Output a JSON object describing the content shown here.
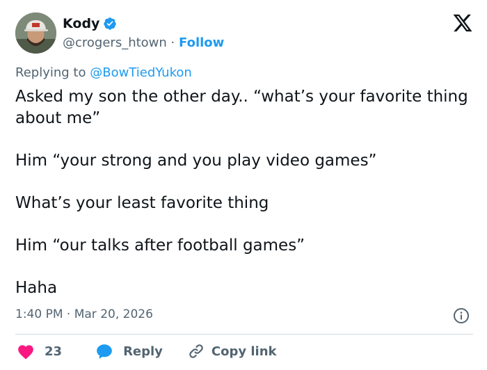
{
  "author": {
    "display_name": "Kody",
    "handle": "@crogers_htown",
    "separator": "·",
    "follow_label": "Follow"
  },
  "reply_context": {
    "prefix": "Replying to",
    "mention": "@BowTiedYukon"
  },
  "tweet": {
    "paragraphs": [
      "Asked my son the other day.. “what’s your favorite thing about me”",
      "Him “your strong and you play video games”",
      "What’s your least favorite thing",
      "Him “our talks after football games”",
      "Haha"
    ],
    "time": "1:40 PM",
    "separator": "·",
    "date": "Mar 20, 2026"
  },
  "actions": {
    "like_count": "23",
    "reply_label": "Reply",
    "copy_link_label": "Copy link"
  },
  "icons": {
    "verified": "verified-badge-icon",
    "brand": "x-logo-icon",
    "info": "info-icon",
    "like": "heart-icon",
    "reply": "speech-bubble-icon",
    "copy": "link-icon"
  },
  "colors": {
    "text": "#0f1419",
    "secondary": "#536471",
    "accent": "#1d9bf0",
    "like": "#f91880",
    "divider": "#cfd9de"
  }
}
